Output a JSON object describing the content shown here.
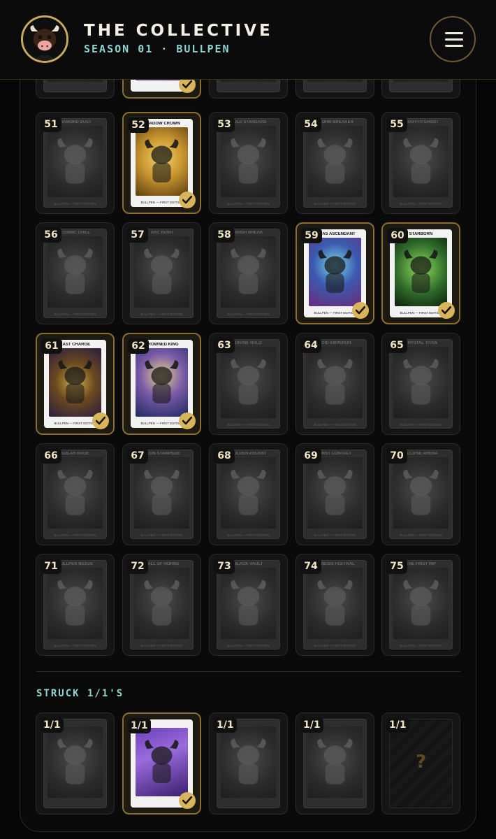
{
  "header": {
    "title": "THE COLLECTIVE",
    "subtitle": "SEASON 01 · BULLPEN",
    "menu_icon": "hamburger-menu-icon"
  },
  "colors": {
    "accent_gold": "#d8b45a",
    "accent_teal": "#8fd3d1",
    "background": "#050505"
  },
  "partial_row_top": [
    {
      "owned": false
    },
    {
      "owned": true
    },
    {
      "owned": false
    },
    {
      "owned": false
    },
    {
      "owned": false
    }
  ],
  "cards": [
    {
      "number": "51",
      "name": "DIAMOND DUST",
      "owned": false
    },
    {
      "number": "52",
      "name": "SHADOW CROWN",
      "owned": true
    },
    {
      "number": "53",
      "name": "GOLD STANDARD",
      "owned": false
    },
    {
      "number": "54",
      "name": "STORM BREAKER",
      "owned": false
    },
    {
      "number": "55",
      "name": "GRAFFITI GHOST",
      "owned": false
    },
    {
      "number": "56",
      "name": "COSMIC CHILL",
      "owned": false
    },
    {
      "number": "57",
      "name": "ARC RUSH",
      "owned": false
    },
    {
      "number": "58",
      "name": "BRISH BREAK",
      "owned": false
    },
    {
      "number": "59",
      "name": "MIDAS ASCENDANT",
      "owned": true
    },
    {
      "number": "60",
      "name": "STARBORN",
      "owned": true
    },
    {
      "number": "61",
      "name": "LAST CHARGE",
      "owned": true
    },
    {
      "number": "62",
      "name": "CROWNED KING",
      "owned": true
    },
    {
      "number": "63",
      "name": "DIVINE HALO",
      "owned": false
    },
    {
      "number": "64",
      "name": "VOID EMPEROR",
      "owned": false
    },
    {
      "number": "65",
      "name": "CRYSTAL TITAN",
      "owned": false
    },
    {
      "number": "66",
      "name": "SOLAR RAGE",
      "owned": false
    },
    {
      "number": "67",
      "name": "NEON STAMPEDE",
      "owned": false
    },
    {
      "number": "68",
      "name": "GOLDEN ASCENT",
      "owned": false
    },
    {
      "number": "69",
      "name": "FIRST CONTACT",
      "owned": false
    },
    {
      "number": "70",
      "name": "ECLIPSE ARENA",
      "owned": false
    },
    {
      "number": "71",
      "name": "BULLPEN NEXUS",
      "owned": false
    },
    {
      "number": "72",
      "name": "HALL OF HORNS",
      "owned": false
    },
    {
      "number": "73",
      "name": "BLACK VAULT",
      "owned": false
    },
    {
      "number": "74",
      "name": "GENESIS FESTIVAL",
      "owned": false
    },
    {
      "number": "75",
      "name": "THE FIRST RIP",
      "owned": false
    }
  ],
  "card_footer": "BULLPEN — FIRST EDITION",
  "struck_section": {
    "label": "STRUCK 1/1'S",
    "cards": [
      {
        "number": "1/1",
        "owned": false,
        "revealed": true
      },
      {
        "number": "1/1",
        "owned": true,
        "revealed": true
      },
      {
        "number": "1/1",
        "owned": false,
        "revealed": true
      },
      {
        "number": "1/1",
        "owned": false,
        "revealed": true
      },
      {
        "number": "1/1",
        "owned": false,
        "revealed": false,
        "mystery": "?"
      }
    ]
  }
}
